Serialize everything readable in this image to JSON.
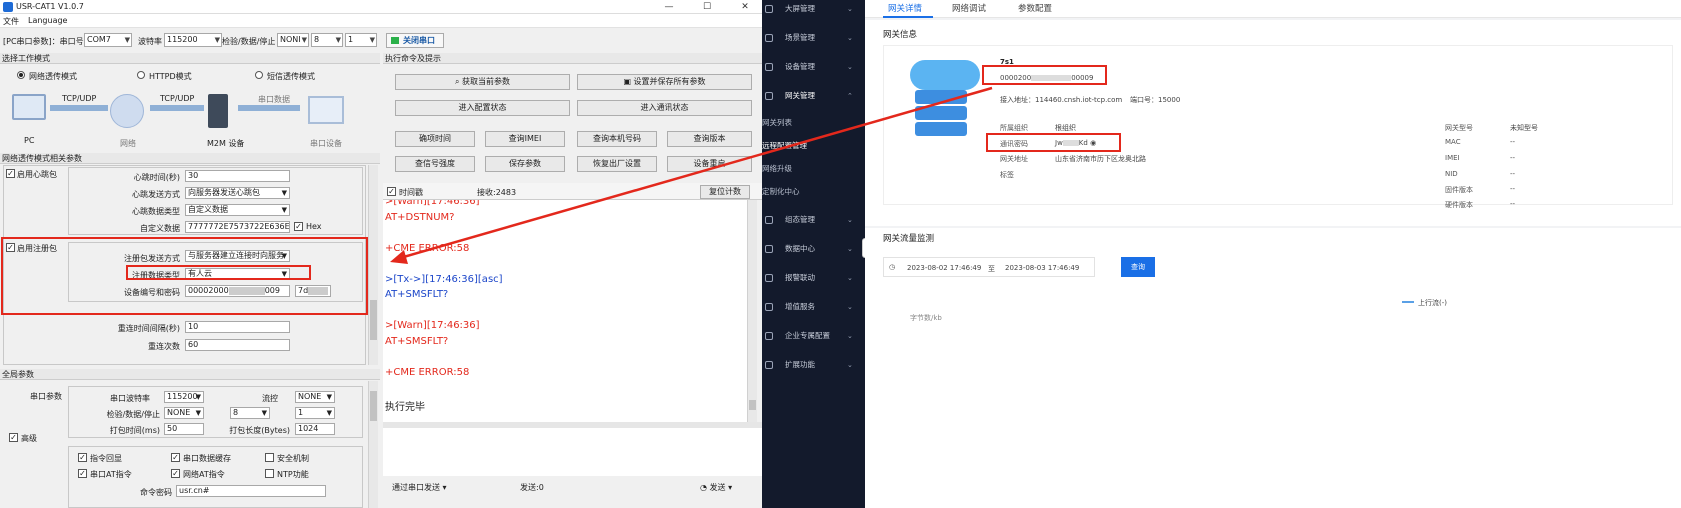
{
  "window": {
    "title": "USR-CAT1 V1.0.7",
    "minimize": "—",
    "maximize": "☐",
    "close": "✕"
  },
  "menu": {
    "file": "文件",
    "language": "Language"
  },
  "toolbar": {
    "port_label": "[PC串口参数]：串口号",
    "port": "COM7",
    "baud_label": "波特率",
    "baud": "115200",
    "check_label": "检验/数据/停止",
    "parity": "NONI",
    "databits": "8",
    "stopbits": "1",
    "open_button": "关闭串口"
  },
  "work_mode": {
    "header": "选择工作模式",
    "modes": [
      "网络透传模式",
      "HTTPD模式",
      "短信透传模式"
    ],
    "diagram": {
      "pc": "PC",
      "net": "网络",
      "m2m": "M2M 设备",
      "serial_dev": "串口设备",
      "tcp1": "TCP/UDP",
      "tcp2": "TCP/UDP",
      "serial_data": "串口数据"
    }
  },
  "net_params": {
    "header": "网络透传模式相关参数",
    "heartbeat_enable": "启用心跳包",
    "heartbeat_time_label": "心跳时间(秒)",
    "heartbeat_time": "30",
    "heartbeat_method_label": "心跳发送方式",
    "heartbeat_method": "向服务器发送心跳包",
    "heartbeat_type_label": "心跳数据类型",
    "heartbeat_type": "自定义数据",
    "custom_data_label": "自定义数据",
    "custom_data": "7777772E7573722E636E",
    "hex_label": "Hex",
    "reg_enable": "启用注册包",
    "reg_method_label": "注册包发送方式",
    "reg_method": "与服务器建立连接时向服务",
    "reg_type_label": "注册数据类型",
    "reg_type": "有人云",
    "device_label": "设备编号和密码",
    "device_id": "00002000",
    "device_id_tail": "009",
    "device_pwd": "7d",
    "reconnect_interval_label": "重连时间间隔(秒)",
    "reconnect_interval": "10",
    "reconnect_times_label": "重连次数",
    "reconnect_times": "60"
  },
  "global": {
    "header": "全局参数",
    "serial_label": "串口参数",
    "baud_label": "串口波特率",
    "baud": "115200",
    "flow_label": "流控",
    "flow": "NONE",
    "check_label": "检验/数据/停止",
    "parity": "NONE",
    "databits": "8",
    "stopbits": "1",
    "pack_time_label": "打包时间(ms)",
    "pack_time": "50",
    "pack_len_label": "打包长度(Bytes)",
    "pack_len": "1024",
    "advanced": "高级",
    "opts": [
      "指令回显",
      "串口数据缓存",
      "安全机制",
      "串口AT指令",
      "网络AT指令",
      "NTP功能"
    ],
    "cmd_pwd_label": "命令密码",
    "cmd_pwd": "usr.cn#"
  },
  "commands": {
    "header": "执行命令及提示",
    "buttons": [
      "获取当前参数",
      "设置并保存所有参数",
      "进入配置状态",
      "进入通讯状态",
      "确项时间",
      "查询IMEI",
      "查询本机号码",
      "查询版本",
      "查信号强度",
      "保存参数",
      "恢复出厂设置",
      "设备重启"
    ],
    "timestamp_label": "时间戳",
    "recv_label": "接收:2483",
    "reset_count": "复位计数",
    "send_via": "通过串口发送",
    "send_count": "发送:0",
    "send_button": "发送"
  },
  "log": [
    {
      "text": ">[Warn][17:46:36]",
      "color": "red"
    },
    {
      "text": "AT+DSTNUM?",
      "color": "red"
    },
    {
      "text": "",
      "color": "red"
    },
    {
      "text": "+CME ERROR:58",
      "color": "red"
    },
    {
      "text": "",
      "color": "red"
    },
    {
      "text": ">[Tx->][17:46:36][asc]",
      "color": "blue"
    },
    {
      "text": "AT+SMSFLT?",
      "color": "blue"
    },
    {
      "text": "",
      "color": "blue"
    },
    {
      "text": ">[Warn][17:46:36]",
      "color": "red"
    },
    {
      "text": "AT+SMSFLT?",
      "color": "red"
    },
    {
      "text": "",
      "color": "red"
    },
    {
      "text": "+CME ERROR:58",
      "color": "red"
    },
    {
      "text": "",
      "color": "red"
    },
    {
      "text": "执行完毕",
      "color": "dark"
    }
  ],
  "sidebar": {
    "items": [
      "大屏管理",
      "场景管理",
      "设备管理",
      "网关管理",
      "组态管理",
      "数据中心",
      "报警联动",
      "增值服务",
      "企业专属配置",
      "扩展功能"
    ],
    "subitems": [
      "网关列表",
      "远程配置管理",
      "网络升级",
      "定制化中心"
    ]
  },
  "gateway": {
    "tabs": [
      "网关详情",
      "网络调试",
      "参数配置"
    ],
    "info_title": "网关信息",
    "name": "7s1",
    "sn": "0000200",
    "sn_tail": "00009",
    "access_label": "接入地址：114460.cnsh.iot-tcp.com",
    "port_label": "端口号：15000",
    "org_label": "所属组织",
    "org": "根组织",
    "pwd_label": "通讯密码",
    "pwd": "Jw",
    "pwd_tail": "Kd",
    "addr_label": "网关地址",
    "addr": "山东省济南市历下区龙奥北路",
    "tag_label": "标签",
    "model_label": "网关型号",
    "model": "未知型号",
    "mac_label": "MAC",
    "imei_label": "IMEI",
    "nid_label": "NID",
    "fw_label": "固件版本",
    "hw_label": "硬件版本",
    "empty": "--",
    "monitor_title": "网关流量监测",
    "date_from": "2023-08-02 17:46:49",
    "date_sep": "至",
    "date_to": "2023-08-03 17:46:49",
    "query": "查询",
    "legend": "上行流(-)",
    "yunit": "字节数/kb"
  },
  "colors": {
    "accent": "#1a6fe6",
    "highlight": "#e3281c",
    "sidebar": "#131a2c"
  }
}
